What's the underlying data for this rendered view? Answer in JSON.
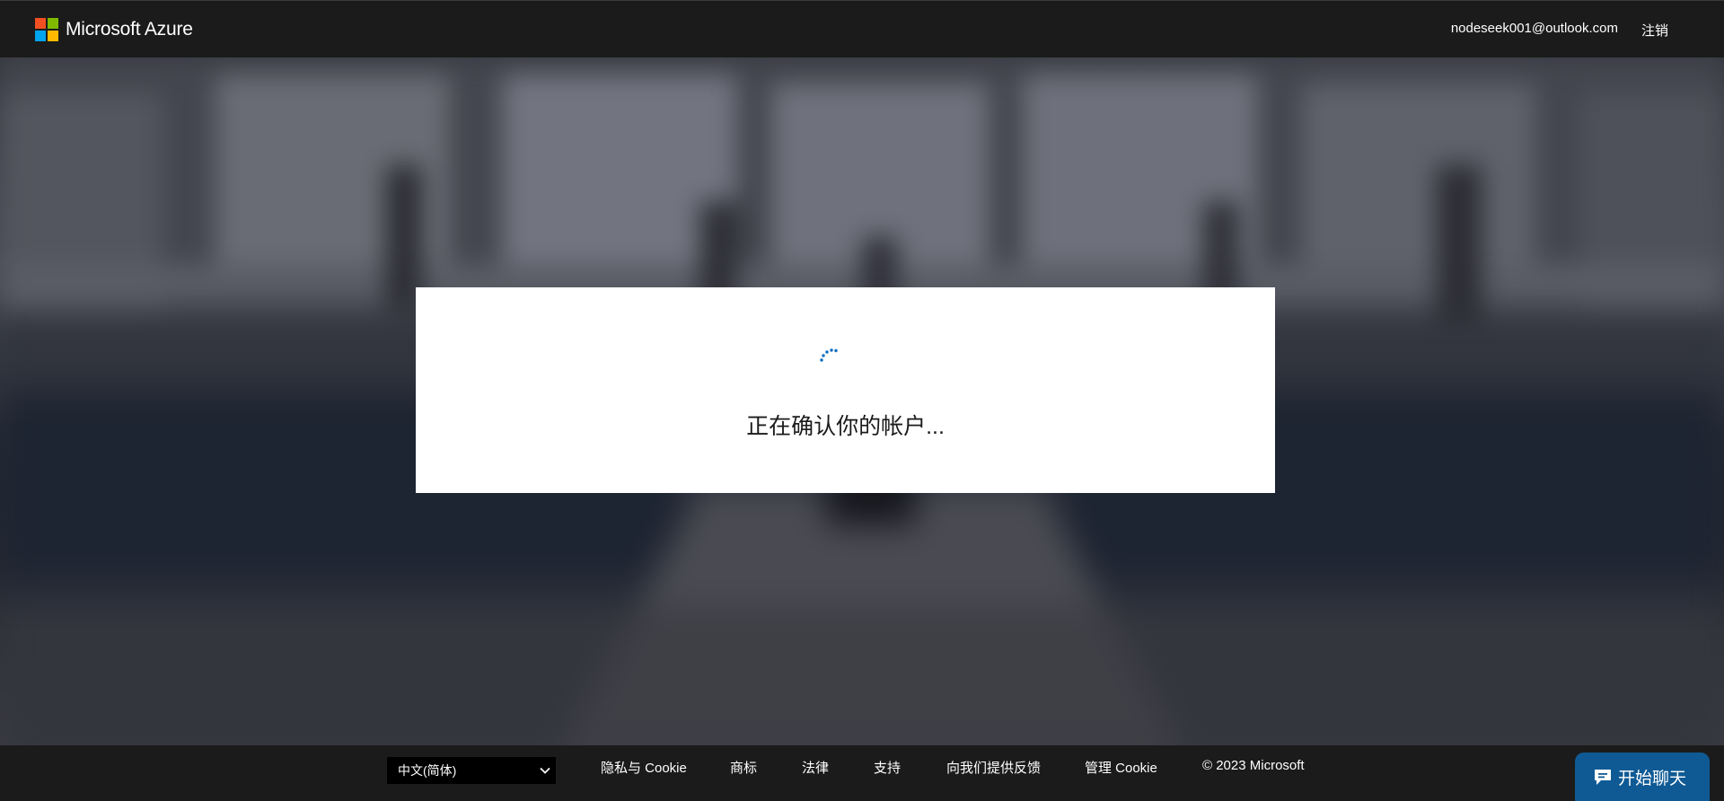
{
  "header": {
    "brand": "Microsoft Azure",
    "user_email": "nodeseek001@outlook.com",
    "signout_label": "注销",
    "logo_colors": [
      "#f25022",
      "#7fba00",
      "#00a4ef",
      "#ffb900"
    ]
  },
  "dialog": {
    "status_text": "正在确认你的帐户...",
    "spinner_color": "#0f6cbd"
  },
  "footer": {
    "language_selected": "中文(简体)",
    "links": {
      "privacy": "隐私与 Cookie",
      "trademarks": "商标",
      "legal": "法律",
      "support": "支持",
      "feedback": "向我们提供反馈",
      "manage_cookies": "管理 Cookie"
    },
    "copyright": "© 2023 Microsoft"
  },
  "chat": {
    "label": "开始聊天",
    "color": "#0f5a94"
  }
}
